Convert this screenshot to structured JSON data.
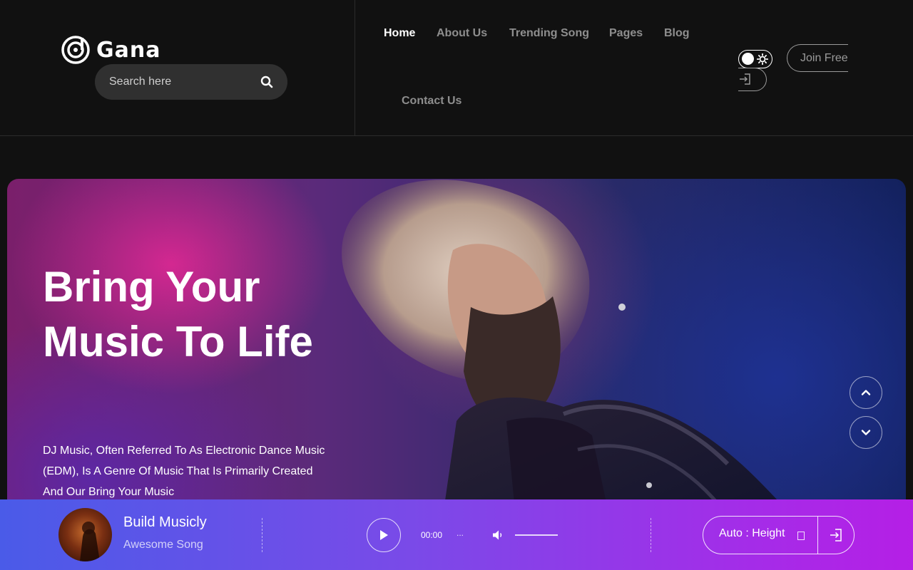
{
  "header": {
    "logo_text": "Gana",
    "search_placeholder": "Search here",
    "nav": [
      {
        "label": "Home",
        "active": true
      },
      {
        "label": "About Us",
        "active": false
      },
      {
        "label": "Trending Song",
        "active": false
      },
      {
        "label": "Pages",
        "active": false
      },
      {
        "label": "Blog",
        "active": false
      },
      {
        "label": "Contact Us",
        "active": false
      }
    ],
    "join_label": "Join Free",
    "theme_toggle_icon": "sun-icon",
    "login_icon": "login-icon"
  },
  "hero": {
    "title": "Bring Your Music To Life",
    "description": "DJ Music, Often Referred To As Electronic Dance Music (EDM), Is A Genre Of Music That Is Primarily Created And Our Bring Your Music",
    "arrow_up_icon": "chevron-up-icon",
    "arrow_down_icon": "chevron-down-icon"
  },
  "player": {
    "song_title": "Build Musicly",
    "song_artist": "Awesome Song",
    "time": "00:00",
    "dots": "...",
    "auto_label": "Auto : Height",
    "colors": {
      "start": "#4a5be8",
      "end": "#b51fe6"
    }
  }
}
